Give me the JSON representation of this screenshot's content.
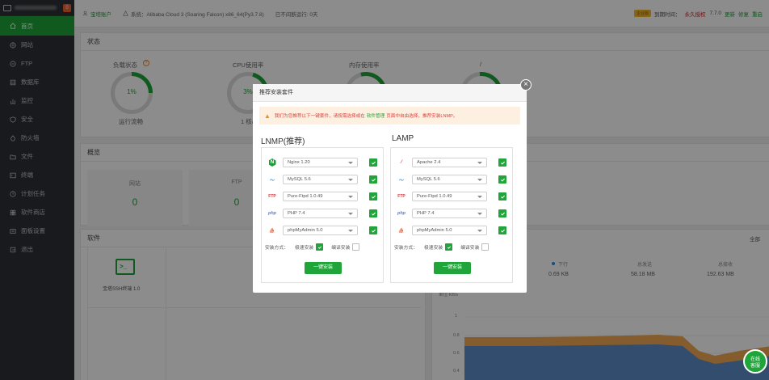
{
  "sidebar": {
    "badge": "0",
    "items": [
      {
        "label": "首页",
        "icon": "home-icon",
        "active": true
      },
      {
        "label": "网站",
        "icon": "globe-icon"
      },
      {
        "label": "FTP",
        "icon": "ftp-icon"
      },
      {
        "label": "数据库",
        "icon": "database-icon"
      },
      {
        "label": "监控",
        "icon": "monitor-icon"
      },
      {
        "label": "安全",
        "icon": "shield-icon"
      },
      {
        "label": "防火墙",
        "icon": "firewall-icon"
      },
      {
        "label": "文件",
        "icon": "folder-icon"
      },
      {
        "label": "终端",
        "icon": "terminal-icon"
      },
      {
        "label": "计划任务",
        "icon": "clock-icon"
      },
      {
        "label": "软件商店",
        "icon": "store-icon"
      },
      {
        "label": "面板设置",
        "icon": "settings-icon"
      },
      {
        "label": "退出",
        "icon": "logout-icon"
      }
    ]
  },
  "topbar": {
    "user": "宝塔账户",
    "system": "系统：Alibaba Cloud 3 (Soaring Falcon) x86_64(Py3.7.8)",
    "uptime": "已不间断运行: 0天",
    "vip": "企业版",
    "expire_label": "到期时间：",
    "expire_value": "永久授权",
    "version": "7.7.0",
    "update": "更新",
    "fix": "修复",
    "restart": "重启"
  },
  "status": {
    "title": "状态",
    "gauges": [
      {
        "label": "负载状态",
        "value": "1%",
        "sub": "运行流畅"
      },
      {
        "label": "CPU使用率",
        "value": "3%",
        "sub": "1 核心"
      },
      {
        "label": "内存使用率",
        "value": "",
        "sub": ""
      },
      {
        "label": "/",
        "value": "",
        "sub": ""
      }
    ]
  },
  "overview": {
    "title": "概览",
    "boxes": [
      {
        "label": "网站",
        "value": "0"
      },
      {
        "label": "FTP",
        "value": "0"
      }
    ]
  },
  "software": {
    "title": "软件",
    "item": "宝塔SSH终端 1.0"
  },
  "traffic": {
    "all": "全部",
    "stats": [
      {
        "label": "下行",
        "value": "0.69 KB"
      },
      {
        "label": "总发送",
        "value": "58.18 MB"
      },
      {
        "label": "总接收",
        "value": "192.63 MB"
      }
    ],
    "unit": "单位:KB/s",
    "yticks": [
      "1",
      "0.8",
      "0.6",
      "0.4"
    ]
  },
  "modal": {
    "title": "推荐安装套件",
    "close": "×",
    "warning_prefix": "我们为您推荐以下一键套件，请按需选择或在",
    "warning_link": "软件管理",
    "warning_suffix": "页面中自由选择，推荐安装LNMP。",
    "mode_label": "安装方式：",
    "fast": "极速安装",
    "compile": "编译安装",
    "install_btn": "一键安装",
    "lnmp": {
      "title": "LNMP(推荐)",
      "rows": [
        {
          "icon": "nginx-icon",
          "value": "Nginx 1.20"
        },
        {
          "icon": "mysql-icon",
          "value": "MySQL 5.6"
        },
        {
          "icon": "ftp-icon",
          "value": "Pure-Ftpd 1.0.49"
        },
        {
          "icon": "php-icon",
          "value": "PHP 7.4"
        },
        {
          "icon": "phpmyadmin-icon",
          "value": "phpMyAdmin 5.0"
        }
      ]
    },
    "lamp": {
      "title": "LAMP",
      "rows": [
        {
          "icon": "apache-icon",
          "value": "Apache 2.4"
        },
        {
          "icon": "mysql-icon",
          "value": "MySQL 5.6"
        },
        {
          "icon": "ftp-icon",
          "value": "Pure-Ftpd 1.0.49"
        },
        {
          "icon": "php-icon",
          "value": "PHP 7.4"
        },
        {
          "icon": "phpmyadmin-icon",
          "value": "phpMyAdmin 5.0"
        }
      ]
    }
  },
  "online": {
    "line1": "在线",
    "line2": "客服"
  },
  "colors": {
    "accent": "#20a53a",
    "sidebar": "#2f3136",
    "warning_bg": "#fdf0e0",
    "warning_text": "#e04040"
  }
}
